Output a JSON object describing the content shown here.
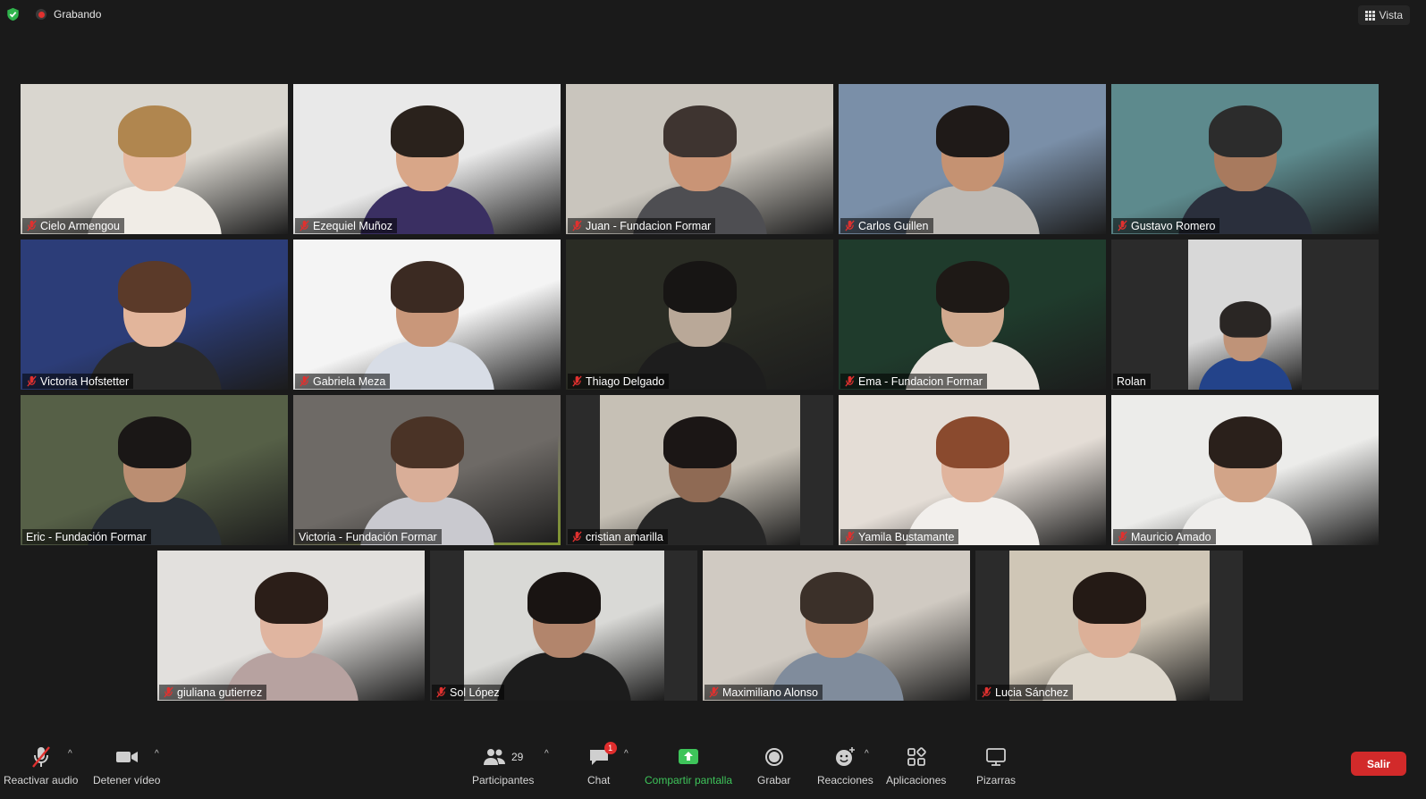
{
  "header": {
    "recording_label": "Grabando",
    "view_label": "Vista"
  },
  "participants": [
    {
      "name": "Cielo Armengou",
      "muted": true,
      "bg": "#d9d6cf",
      "skin": "#e6b9a0",
      "hair": "#b0864f",
      "shirt": "#f0ece6"
    },
    {
      "name": "Ezequiel Muñoz",
      "muted": true,
      "bg": "#e9e9e9",
      "skin": "#d8a688",
      "hair": "#2a221c",
      "shirt": "#3a2f62"
    },
    {
      "name": "Juan - Fundacion Formar",
      "muted": true,
      "bg": "#c9c5bd",
      "skin": "#c99476",
      "hair": "#3e3430",
      "shirt": "#4e4e52"
    },
    {
      "name": "Carlos Guillen",
      "muted": true,
      "bg": "#7a8fa8",
      "skin": "#c59272",
      "hair": "#1f1a18",
      "shirt": "#bdbab5"
    },
    {
      "name": "Gustavo Romero",
      "muted": true,
      "bg": "#5d8a8d",
      "skin": "#a87a5e",
      "hair": "#2c2c2c",
      "shirt": "#2a2f3c"
    },
    {
      "name": "Victoria Hofstetter",
      "muted": true,
      "bg": "#2c3d78",
      "skin": "#e2b59b",
      "hair": "#5b3a29",
      "shirt": "#2a2a2a"
    },
    {
      "name": "Gabriela Meza",
      "muted": true,
      "bg": "#f4f4f4",
      "skin": "#c9977a",
      "hair": "#3b2a22",
      "shirt": "#d8dde6"
    },
    {
      "name": "Thiago Delgado",
      "muted": true,
      "bg": "#2a2c24",
      "skin": "#b9a898",
      "hair": "#171514",
      "shirt": "#1d1d1d"
    },
    {
      "name": "Ema - Fundacion Formar",
      "muted": true,
      "bg": "#1f3b2c",
      "skin": "#d0a98e",
      "hair": "#1e1916",
      "shirt": "#e7e2dc"
    },
    {
      "name": "Rolan",
      "muted": false,
      "bg": "#d8d8d8",
      "skin": "#bf9378",
      "hair": "#2a2624",
      "shirt": "#23438a"
    },
    {
      "name": "Eric - Fundación Formar",
      "muted": false,
      "bg": "#566047",
      "skin": "#bb8e72",
      "hair": "#1a1716",
      "shirt": "#2a3037"
    },
    {
      "name": "Victoria - Fundación Formar",
      "muted": false,
      "bg": "#6e6a66",
      "skin": "#d9ae98",
      "hair": "#4a3326",
      "shirt": "#c9c9cf"
    },
    {
      "name": "cristian amarilla",
      "muted": true,
      "bg": "#c6c0b5",
      "skin": "#8f6a54",
      "hair": "#1b1615",
      "shirt": "#262626"
    },
    {
      "name": "Yamila Bustamante",
      "muted": true,
      "bg": "#e4ddd6",
      "skin": "#e0b49d",
      "hair": "#8a4a2e",
      "shirt": "#f2efec"
    },
    {
      "name": "Mauricio Amado",
      "muted": true,
      "bg": "#ececea",
      "skin": "#d2a488",
      "hair": "#2a201b",
      "shirt": "#efeeec"
    },
    {
      "name": "giuliana gutierrez",
      "muted": true,
      "bg": "#e2e0dd",
      "skin": "#e0b5a0",
      "hair": "#2b1e18",
      "shirt": "#b7a2a0"
    },
    {
      "name": "Sol López",
      "muted": true,
      "bg": "#d9d9d6",
      "skin": "#b2856c",
      "hair": "#191412",
      "shirt": "#1c1c1c"
    },
    {
      "name": "Maximiliano Alonso",
      "muted": true,
      "bg": "#d0cac2",
      "skin": "#c4967a",
      "hair": "#3b3029",
      "shirt": "#808c9c"
    },
    {
      "name": "Lucia Sánchez",
      "muted": true,
      "bg": "#cfc6b6",
      "skin": "#dcb098",
      "hair": "#241a15",
      "shirt": "#ded8cd"
    }
  ],
  "toolbar": {
    "unmute_label": "Reactivar audio",
    "stop_video_label": "Detener vídeo",
    "participants_label": "Participantes",
    "participants_count": "29",
    "chat_label": "Chat",
    "chat_badge": "1",
    "share_label": "Compartir pantalla",
    "record_label": "Grabar",
    "reactions_label": "Reacciones",
    "apps_label": "Aplicaciones",
    "whiteboards_label": "Pizarras",
    "leave_label": "Salir"
  },
  "colors": {
    "active_speaker_border": "#c8e94a",
    "share_green": "#3ec45a",
    "leave_red": "#d22a2a",
    "muted_red": "#e0312f"
  }
}
